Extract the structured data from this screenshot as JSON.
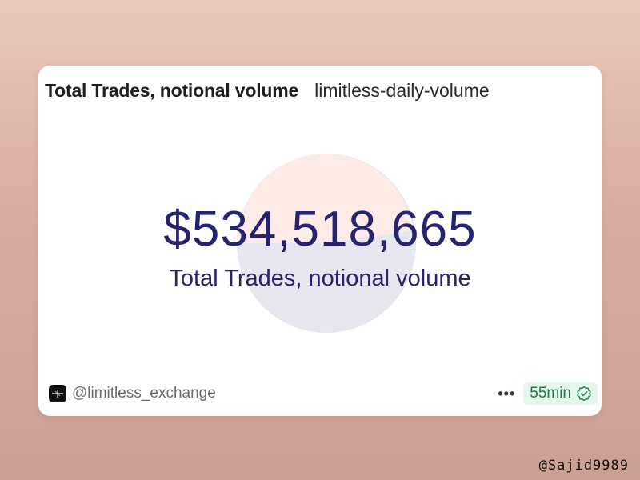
{
  "card": {
    "title": "Total Trades, notional volume",
    "query_name": "limitless-daily-volume"
  },
  "counter": {
    "value": "$534,518,665",
    "label": "Total Trades, notional volume"
  },
  "footer": {
    "author": "@limitless_exchange",
    "more_label": "•••",
    "freshness": "55min",
    "freshness_icon": "verified-check-icon",
    "author_icon": "limitless-logo-icon"
  },
  "watermark": "@Sajid9989",
  "colors": {
    "counter_text": "#26246e",
    "badge_bg": "#e5f6ea",
    "badge_text": "#1f7a44",
    "pie_light_pink": "#fcebe6",
    "pie_light_blue": "#e6e8ef"
  }
}
